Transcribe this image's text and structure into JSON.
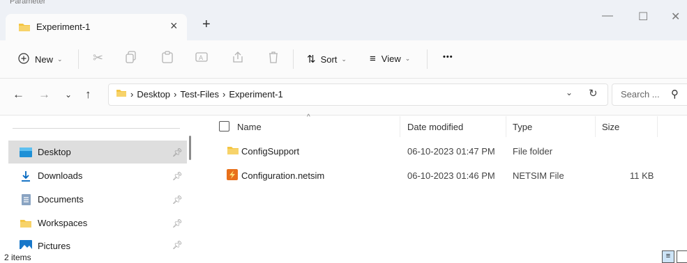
{
  "window": {
    "ghost_tab": "Parameter",
    "tab_title": "Experiment-1",
    "tab_close": "×",
    "new_tab": "+",
    "minimize": "—",
    "maximize": "☐",
    "close": "✕"
  },
  "toolbar": {
    "new_label": "New",
    "sort_label": "Sort",
    "view_label": "View",
    "more_label": "•••"
  },
  "address": {
    "breadcrumbs": [
      "Desktop",
      "Test-Files",
      "Experiment-1"
    ],
    "search_placeholder": "Search ..."
  },
  "nav_pane": {
    "items": [
      {
        "label": "Desktop",
        "icon": "desktop-icon",
        "selected": true
      },
      {
        "label": "Downloads",
        "icon": "download-icon",
        "selected": false
      },
      {
        "label": "Documents",
        "icon": "documents-icon",
        "selected": false
      },
      {
        "label": "Workspaces",
        "icon": "folder-icon",
        "selected": false
      },
      {
        "label": "Pictures",
        "icon": "pictures-icon",
        "selected": false
      }
    ]
  },
  "file_list": {
    "columns": [
      "Name",
      "Date modified",
      "Type",
      "Size"
    ],
    "rows": [
      {
        "name": "ConfigSupport",
        "date": "06-10-2023 01:47 PM",
        "type": "File folder",
        "size": ""
      },
      {
        "name": "Configuration.netsim",
        "date": "06-10-2023 01:46 PM",
        "type": "NETSIM File",
        "size": "11 KB"
      }
    ]
  },
  "status": {
    "item_count": "2 items"
  },
  "colors": {
    "folder": "#F4C542",
    "accent": "#0067C0",
    "netsim": "#E8701A"
  }
}
